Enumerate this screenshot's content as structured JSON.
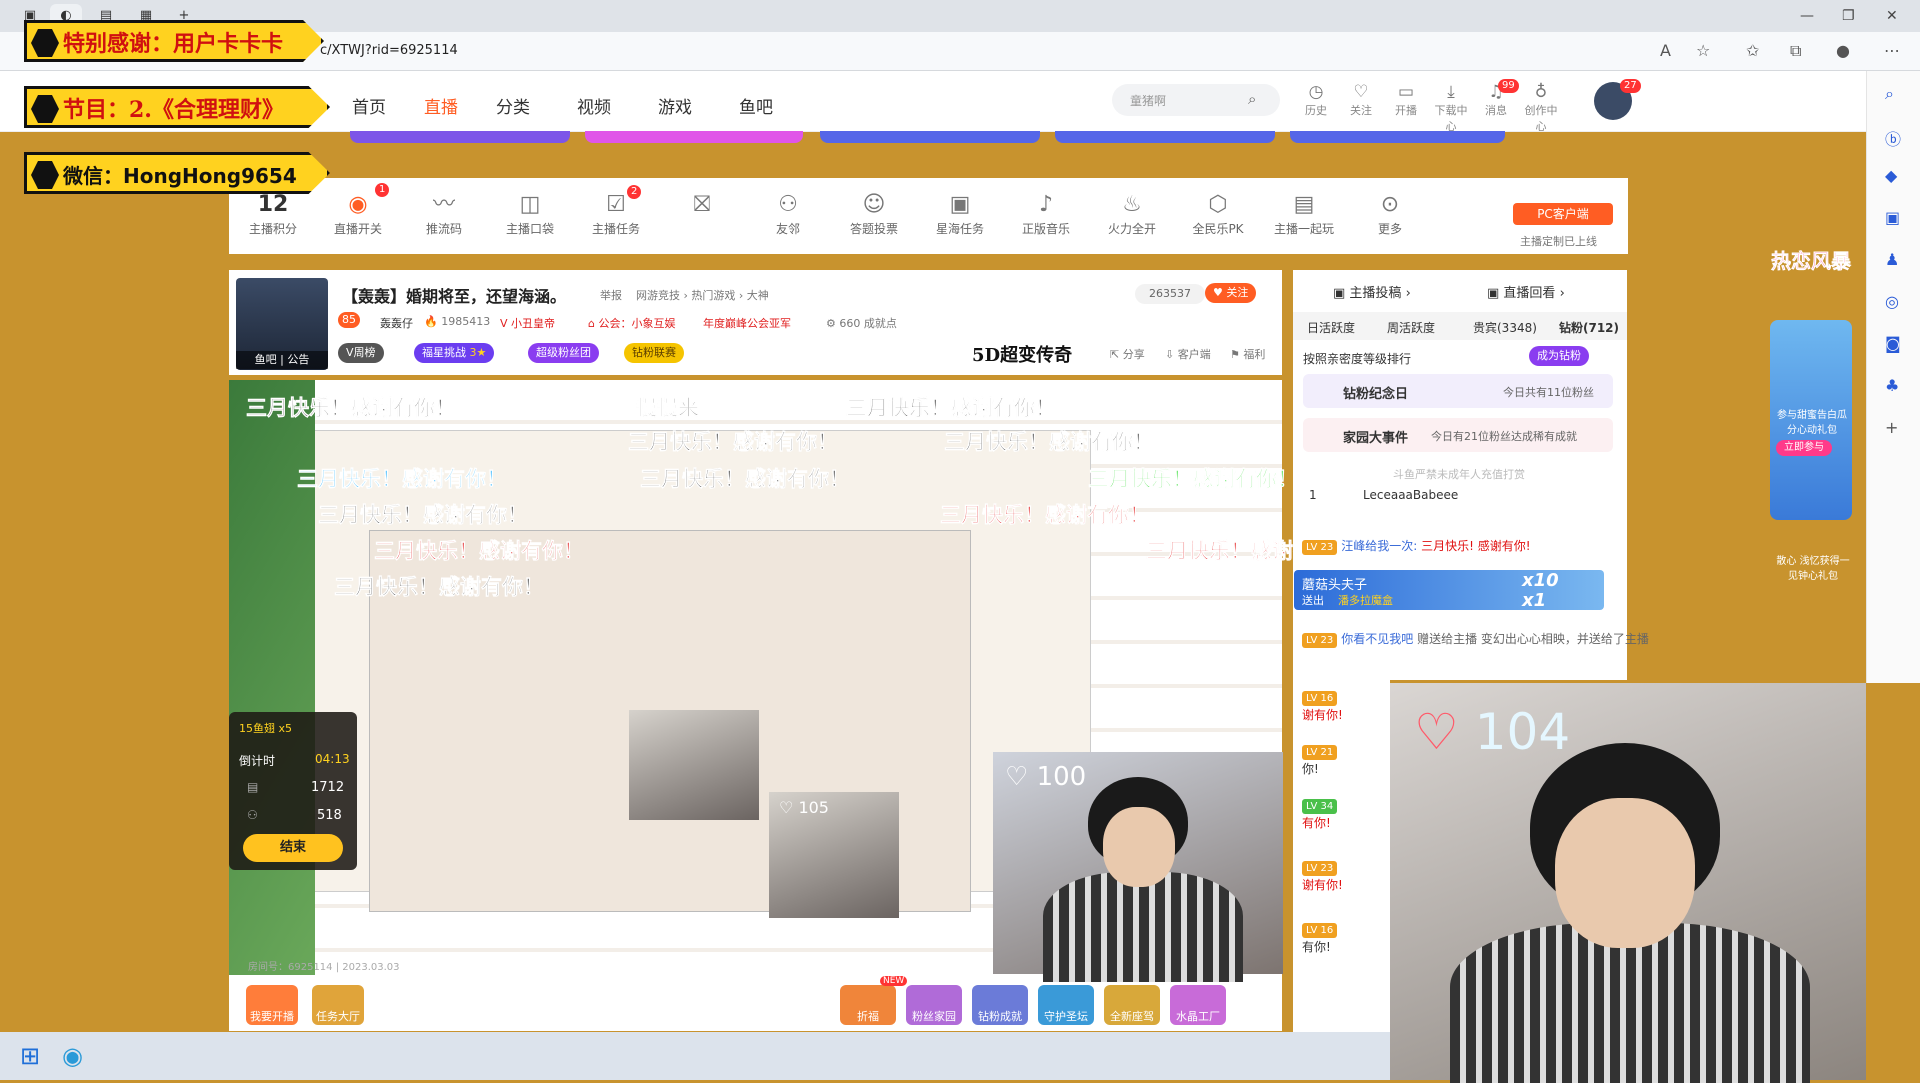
{
  "browser": {
    "url": "c/XTWJ?rid=6925114",
    "window_controls": [
      "—",
      "❐",
      "✕"
    ],
    "new_tab": "+"
  },
  "banners": {
    "thanks": "特别感谢：用户卡卡卡",
    "program": "节目：2.《合理理财》",
    "wechat": "微信：HongHong9654"
  },
  "site_nav": {
    "items": [
      "首页",
      "直播",
      "分类",
      "视频",
      "游戏",
      "鱼吧"
    ],
    "active": "直播",
    "search_placeholder": "童猪啊",
    "header_icons": [
      {
        "label": "历史",
        "icon": "history-icon"
      },
      {
        "label": "关注",
        "icon": "heart-icon"
      },
      {
        "label": "开播",
        "icon": "broadcast-icon"
      },
      {
        "label": "下载中心",
        "icon": "download-icon"
      },
      {
        "label": "消息",
        "icon": "bell-icon",
        "badge": "99"
      },
      {
        "label": "创作中心",
        "icon": "bulb-icon"
      }
    ],
    "avatar_badge": "27"
  },
  "tools": {
    "score_value": "12",
    "items": [
      {
        "label": "主播积分",
        "icon": "score-icon"
      },
      {
        "label": "直播开关",
        "icon": "toggle-icon",
        "badge": "1"
      },
      {
        "label": "推流码",
        "icon": "wave-icon"
      },
      {
        "label": "主播口袋",
        "icon": "pocket-icon"
      },
      {
        "label": "主播任务",
        "icon": "task-icon",
        "badge": "2"
      },
      {
        "label": "",
        "icon": "gift-icon"
      },
      {
        "label": "友邻",
        "icon": "friends-icon"
      },
      {
        "label": "答题投票",
        "icon": "vote-icon"
      },
      {
        "label": "星海任务",
        "icon": "ad-icon"
      },
      {
        "label": "正版音乐",
        "icon": "music-icon"
      },
      {
        "label": "火力全开",
        "icon": "fire-icon"
      },
      {
        "label": "全民乐PK",
        "icon": "pk-icon"
      },
      {
        "label": "主播一起玩",
        "icon": "play-icon"
      },
      {
        "label": "更多",
        "icon": "more-icon"
      }
    ],
    "pc_client": "PC客户端",
    "pc_client_sub": "主播定制已上线"
  },
  "room": {
    "title": "【轰轰】婚期将至，还望海涵。",
    "report": "举报",
    "category": "网游竞技 › 热门游戏 › 大神",
    "hot": "263537",
    "follow": "关注",
    "level": "85",
    "streamer": "轰轰仔",
    "fans": "1985413",
    "guard_tag": "小丑皇帝",
    "guild": "公会：小象互娱",
    "guild_title": "年度巅峰公会亚军",
    "achievement": "660 成就点",
    "rank_pill": "V周榜",
    "pill_blue": "福星挑战",
    "pill_blue_stars": "3★",
    "pill_purple": "超级粉丝团",
    "pill_yellow": "钻粉联赛",
    "avatar_label": "鱼吧 | 公告",
    "logo_5d": "5D超变传奇",
    "share": "分享",
    "client": "客户端",
    "welfare": "福利"
  },
  "right_panel": {
    "tab_left": "主播投稿",
    "tab_right": "直播回看",
    "sub_tabs": [
      "日活跃度",
      "周活跃度",
      "贵宾(3348)",
      "钻粉(712)"
    ],
    "rank_label": "按照亲密度等级排行",
    "become_diamond": "成为钻粉",
    "anniv_title": "钻粉纪念日",
    "anniv_text": "今日共有11位粉丝",
    "event_title": "家园大事件",
    "event_text": "今日有21位粉丝达成稀有成就",
    "notice": "斗鱼严禁未成年人充值打赏",
    "first_fan_rank": "1",
    "first_fan": "LeceaaaBabeee"
  },
  "chat": [
    {
      "lv": "LV 23",
      "user": "汪峰给我一次:",
      "text": "三月快乐! 感谢有你!"
    },
    {
      "lv": "LV 23",
      "user": "你看不见我吧",
      "text": "赠送给主播 变幻出心心相映，并送给了主播"
    },
    {
      "lv": "LV 16",
      "user": "",
      "text": "谢有你!"
    },
    {
      "lv": "LV 21",
      "user": "",
      "text": "你!"
    },
    {
      "lv": "LV 34",
      "user": "",
      "text": "有你!"
    },
    {
      "lv": "LV 23",
      "user": "",
      "text": "谢有你!"
    },
    {
      "lv": "LV 16",
      "user": "",
      "text": "有你!"
    }
  ],
  "gift_popup": {
    "user": "蘑菇头夫子",
    "action": "送出",
    "gift": "潘多拉魔盒",
    "combo_a": "x10",
    "combo_b": "x1"
  },
  "timer": {
    "fish": "15鱼翅 x5",
    "countdown_label": "倒计时",
    "countdown": "04:13",
    "value_a": "1712",
    "value_b": "518",
    "end_button": "结束"
  },
  "bottom_bar": {
    "left": [
      "我要开播",
      "任务大厅"
    ],
    "right": [
      "折福",
      "粉丝家园",
      "钻粉成就",
      "守护圣坛",
      "全新座驾",
      "水晶工厂"
    ],
    "new_tag": "NEW",
    "room_info": "房间号：6925114 | 2023.03.03"
  },
  "danmaku": [
    {
      "text": "三月快乐！感谢有你！",
      "color": "#ffffff"
    },
    {
      "text": "慢慢来",
      "color": "#ffffff"
    },
    {
      "text": "三月快乐！感谢有你！",
      "color": "#ffffff"
    },
    {
      "text": "三月快乐！感谢有你！",
      "color": "#ffffff"
    },
    {
      "text": "三月快乐！感谢有你！",
      "color": "#ffffff"
    },
    {
      "text": "三月快乐！感谢有你！",
      "color": "#1fb0ff"
    },
    {
      "text": "三月快乐！感谢有你！",
      "color": "#ffffff"
    },
    {
      "text": "三月快乐！感谢有你！",
      "color": "#33dd33"
    },
    {
      "text": "三月快乐！感谢有你！",
      "color": "#ffffff"
    },
    {
      "text": "三月快乐！感谢有你！",
      "color": "#e01010"
    },
    {
      "text": "三月快乐！感谢有你！",
      "color": "#e01010"
    },
    {
      "text": "三月快乐！感谢有你！",
      "color": "#e01010"
    },
    {
      "text": "三月快乐！感谢有你！",
      "color": "#ffffff"
    },
    {
      "text": "三月快乐！感",
      "color": "#e01010"
    }
  ],
  "webcam": {
    "hearts_small": "100",
    "hearts_large": "104",
    "nested_hearts": "105"
  },
  "promo": {
    "title": "热恋风暴",
    "text1": "参与甜蜜告白瓜分心动礼包",
    "cta": "立即参与",
    "text2": "散心 浅忆获得一见钟心礼包"
  },
  "colors": {
    "brand_orange": "#ff5d23",
    "banner_yellow": "#ffd21f",
    "background_gold": "#c8932e"
  }
}
